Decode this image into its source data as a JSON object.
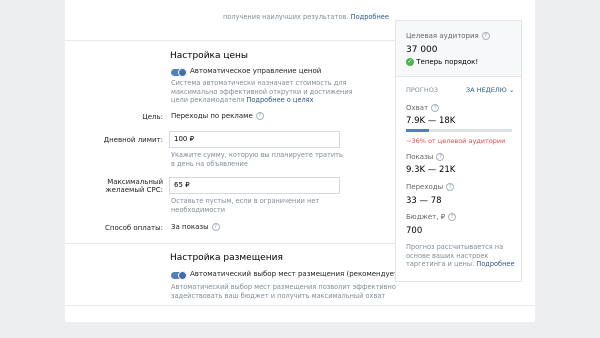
{
  "top_note": {
    "text": "получения наилучших результатов.",
    "link": "Подробнее"
  },
  "price": {
    "section_title": "Настройка цены",
    "auto_toggle_label": "Автоматическое управление ценой",
    "auto_desc": "Система автоматически назначает стоимость для максимально эффективной открутки и достижения цели рекламодателя",
    "auto_desc_link": "Подробнее о целях",
    "goal_label": "Цель:",
    "goal_value": "Переходы по рекламе",
    "daily_limit_label": "Дневной лимит:",
    "daily_limit_value": "100 ₽",
    "daily_limit_hint": "Укажите сумму, которую вы планируете тратить в день на объявление",
    "max_cpc_label_1": "Максимальный",
    "max_cpc_label_2": "желаемый CPC:",
    "max_cpc_value": "65 ₽",
    "max_cpc_hint": "Оставьте пустым, если в ограничении нет необходимости",
    "payment_label": "Способ оплаты:",
    "payment_value": "За показы"
  },
  "placement": {
    "section_title": "Настройка размещения",
    "auto_toggle_label": "Автоматический выбор мест размещения (рекомендуется)",
    "desc": "Автоматический выбор мест размещения позволит эффективно задействовать ваш бюджет и получить максимальный охват"
  },
  "sidebar": {
    "audience_label": "Целевая аудитория",
    "audience_value": "37 000",
    "status_text": "Теперь порядок!",
    "forecast_label": "ПРОГНОЗ",
    "period_label": "ЗА НЕДЕЛЮ",
    "reach_label": "Охват",
    "reach_value": "7.9K — 18K",
    "reach_note": "~36% от целевой аудитории",
    "reach_fraction": 0.22,
    "impressions_label": "Показы",
    "impressions_value": "9.3K — 21K",
    "clicks_label": "Переходы",
    "clicks_value": "33 — 78",
    "budget_label": "Бюджет, ₽",
    "budget_value": "700",
    "footer": "Прогноз рассчитывается на основе ваших настроек таргетинга и цены.",
    "footer_link": "Подробнее"
  },
  "colors": {
    "accent": "#5181b8",
    "link": "#2a5885",
    "success": "#4bb34b",
    "background": "#edeef0"
  }
}
